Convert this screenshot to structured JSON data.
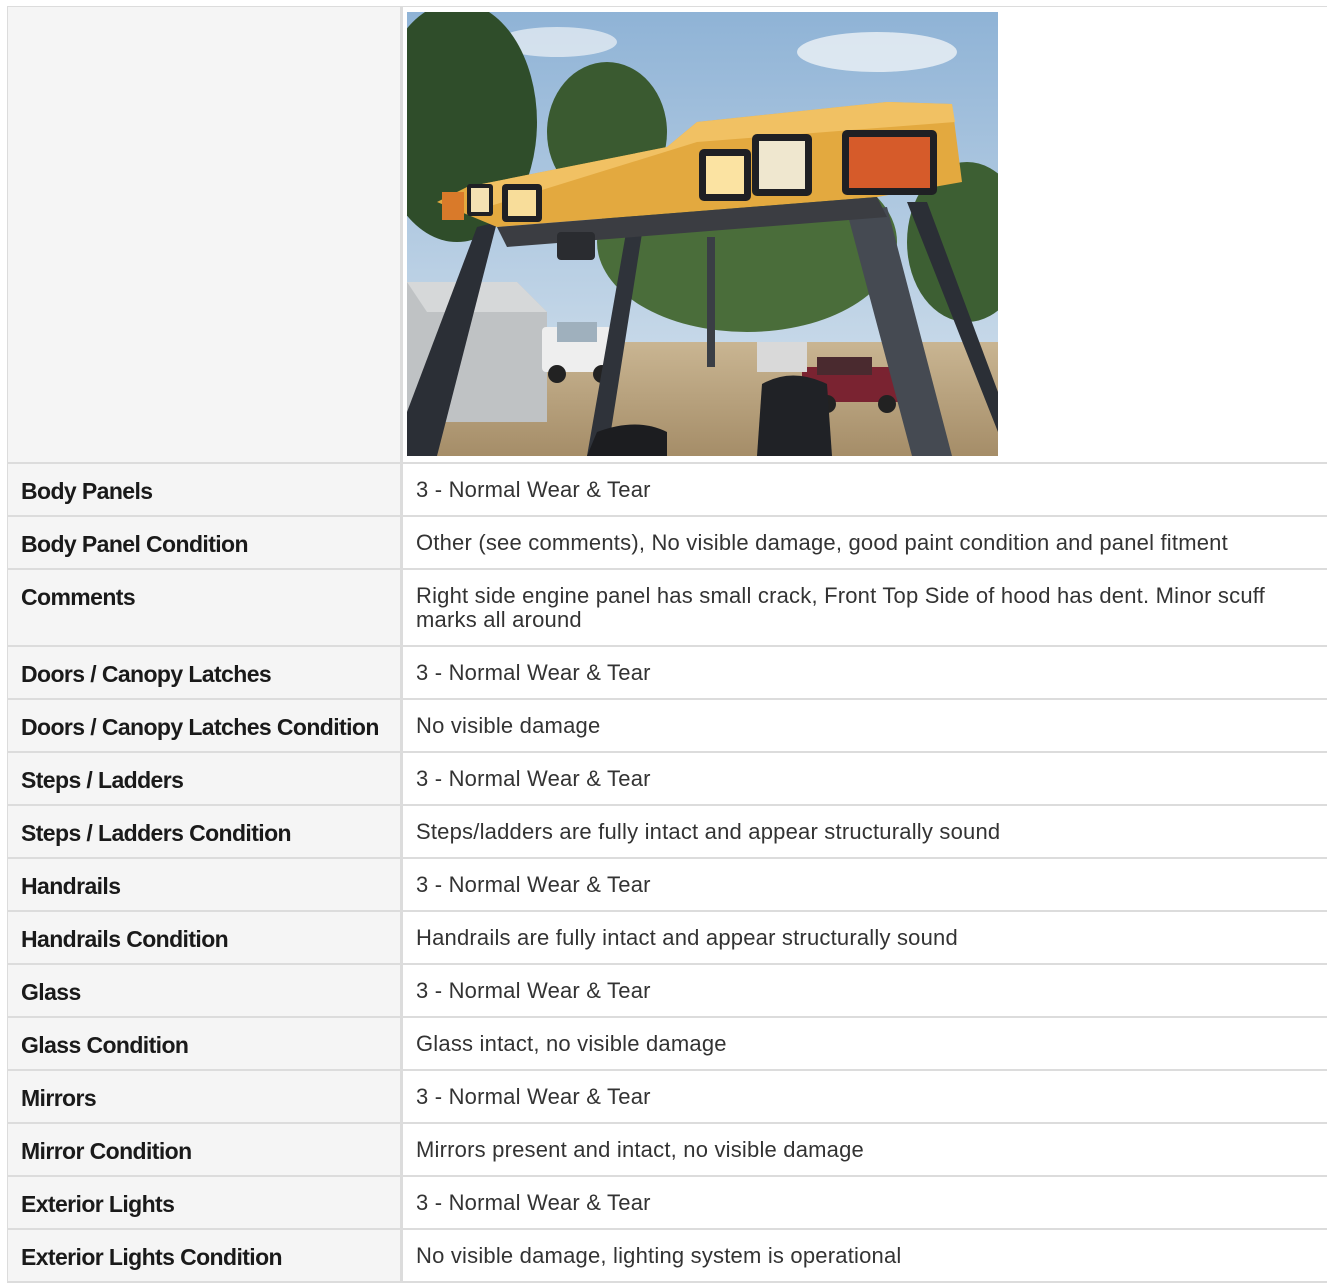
{
  "photo": {
    "icon": "forklift-canopy-photo"
  },
  "rows": [
    {
      "label": "Body Panels",
      "value": "3 - Normal Wear & Tear"
    },
    {
      "label": "Body Panel Condition",
      "value": "Other (see comments), No visible damage, good paint condition and panel fitment"
    },
    {
      "label": "Comments",
      "value": "Right side engine panel has small crack, Front Top Side of hood has dent. Minor scuff marks all around"
    },
    {
      "label": "Doors / Canopy Latches",
      "value": "3 - Normal Wear & Tear"
    },
    {
      "label": "Doors / Canopy Latches Condition",
      "value": "No visible damage"
    },
    {
      "label": "Steps / Ladders",
      "value": "3 - Normal Wear & Tear"
    },
    {
      "label": "Steps / Ladders Condition",
      "value": "Steps/ladders are fully intact and appear structurally sound"
    },
    {
      "label": "Handrails",
      "value": "3 - Normal Wear & Tear"
    },
    {
      "label": "Handrails Condition",
      "value": "Handrails are fully intact and appear structurally sound"
    },
    {
      "label": "Glass",
      "value": "3 - Normal Wear & Tear"
    },
    {
      "label": "Glass Condition",
      "value": "Glass intact, no visible damage"
    },
    {
      "label": "Mirrors",
      "value": "3 - Normal Wear & Tear"
    },
    {
      "label": "Mirror Condition",
      "value": "Mirrors present and intact, no visible damage"
    },
    {
      "label": "Exterior Lights",
      "value": "3 - Normal Wear & Tear"
    },
    {
      "label": "Exterior Lights Condition",
      "value": "No visible damage, lighting system is operational"
    }
  ]
}
